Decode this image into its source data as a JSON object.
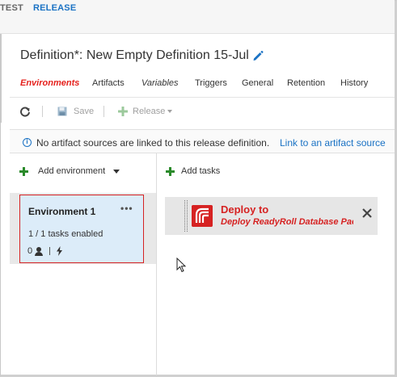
{
  "hub": {
    "tabs": [
      "TEST",
      "RELEASE"
    ]
  },
  "definition": {
    "title": "Definition*: New Empty Definition 15-Jul"
  },
  "tabs": [
    "Environments",
    "Artifacts",
    "Variables",
    "Triggers",
    "General",
    "Retention",
    "History"
  ],
  "active_tab": "Environments",
  "toolbar": {
    "save_label": "Save",
    "release_label": "Release"
  },
  "info": {
    "message": "No artifact sources are linked to this release definition.",
    "link": "Link to an artifact source"
  },
  "environments_panel": {
    "add_environment_label": "Add environment",
    "environment": {
      "name": "Environment 1",
      "tasks_enabled": "1 / 1 tasks enabled",
      "approvers_count": "0",
      "menu": "•••"
    }
  },
  "tasks_panel": {
    "add_tasks_label": "Add tasks",
    "task": {
      "title": "Deploy to",
      "subtitle": "Deploy ReadyRoll Database Package"
    }
  },
  "colors": {
    "accent": "#1a72c4",
    "active_tab": "#e5201c",
    "task_red": "#d62222",
    "add_green": "#2a8a2a",
    "env_card_bg": "#dcecf9"
  },
  "icons": [
    "pencil-icon",
    "refresh-icon",
    "save-icon",
    "release-plus-icon",
    "info-icon",
    "add-icon",
    "person-icon",
    "bolt-icon",
    "readyroll-logo-icon",
    "close-icon",
    "mouse-cursor-icon"
  ]
}
